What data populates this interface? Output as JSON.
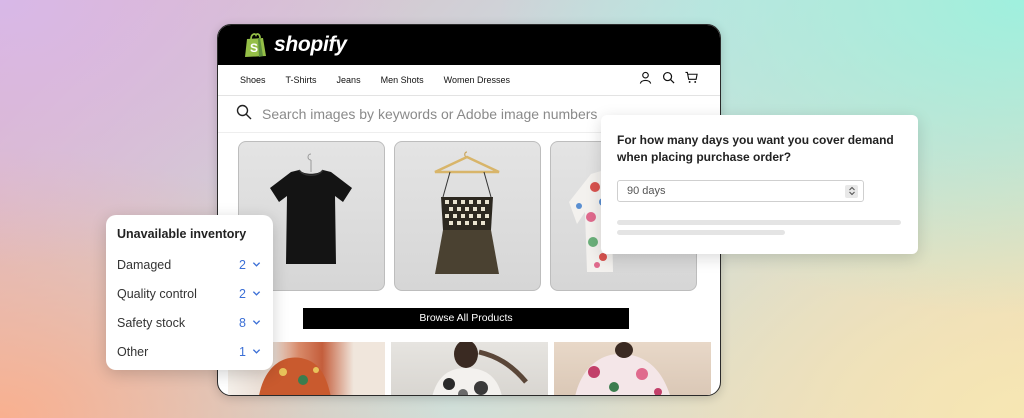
{
  "brand": {
    "name": "shopify",
    "accent": "#95bf47"
  },
  "nav": {
    "items": [
      "Shoes",
      "T-Shirts",
      "Jeans",
      "Men Shots",
      "Women Dresses"
    ],
    "icons": [
      "user-icon",
      "search-icon",
      "cart-icon"
    ]
  },
  "search": {
    "placeholder": "Search images by keywords or Adobe image numbers"
  },
  "products": [
    {
      "name": "black-tshirt"
    },
    {
      "name": "embroidered-top"
    },
    {
      "name": "floral-shirt"
    }
  ],
  "browse_button": "Browse All Products",
  "inventory": {
    "title": "Unavailable inventory",
    "rows": [
      {
        "label": "Damaged",
        "count": "2"
      },
      {
        "label": "Quality control",
        "count": "2"
      },
      {
        "label": "Safety stock",
        "count": "8"
      },
      {
        "label": "Other",
        "count": "1"
      }
    ]
  },
  "demand": {
    "question": "For how many days you want you cover demand when placing purchase order?",
    "selected": "90 days"
  }
}
